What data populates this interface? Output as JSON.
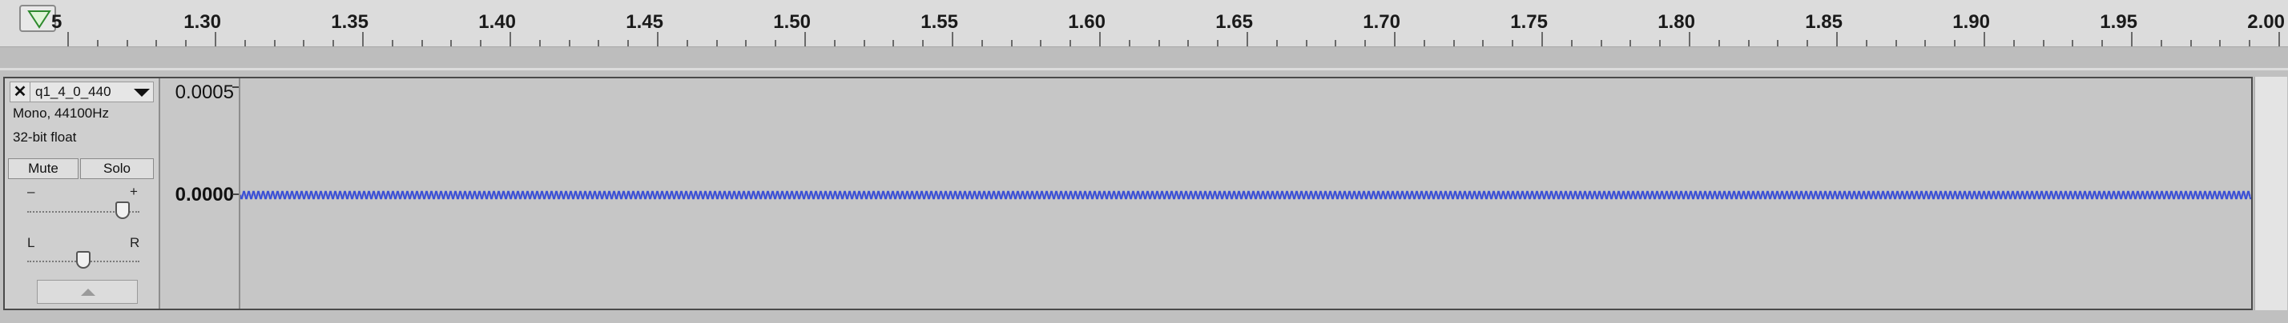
{
  "ruler": {
    "left_partial_label": "5",
    "tick_labels": [
      "1.30",
      "1.35",
      "1.40",
      "1.45",
      "1.50",
      "1.55",
      "1.60",
      "1.65",
      "1.70",
      "1.75",
      "1.80",
      "1.85",
      "1.90",
      "1.95",
      "2.00"
    ]
  },
  "track": {
    "name": "q1_4_0_440",
    "format_line1": "Mono, 44100Hz",
    "format_line2": "32-bit float",
    "close_glyph": "✕",
    "mute_label": "Mute",
    "solo_label": "Solo",
    "gain_minus": "–",
    "gain_plus": "+",
    "pan_left": "L",
    "pan_right": "R",
    "gain_level": 0.85,
    "pan_level": 0.5
  },
  "vertical_ruler": {
    "top_label": "0.0005",
    "mid_label": "0.0000"
  },
  "waveform": {
    "color": "#3a4fd6",
    "amplitude_hint": "near zero, periodic"
  },
  "colors": {
    "track_bg": "#c6c6c6",
    "waveform": "#3a4fd6",
    "playhead_arrow": "#3aa83a"
  }
}
